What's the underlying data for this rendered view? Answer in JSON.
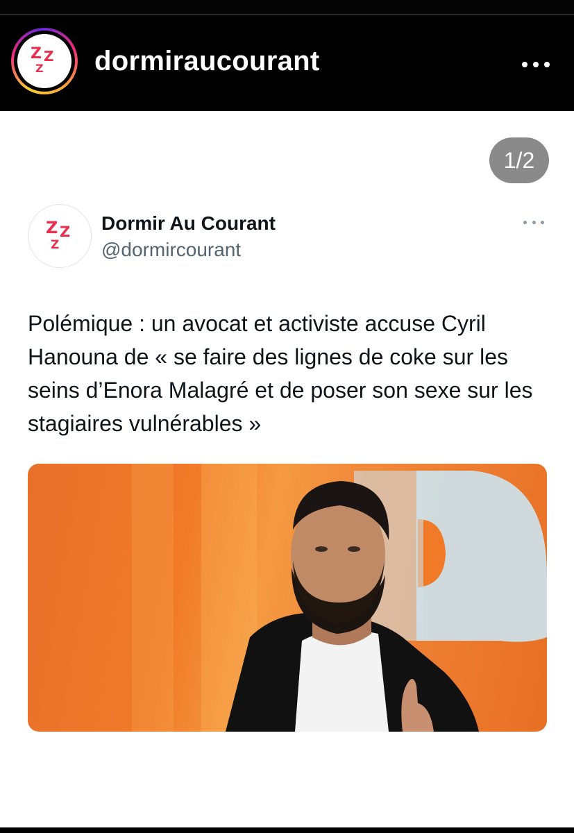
{
  "header": {
    "username": "dormiraucourant",
    "avatar_icon": "zzz-logo-icon",
    "more_icon": "more-horizontal-icon"
  },
  "post": {
    "counter": "1/2",
    "tweet": {
      "display_name": "Dormir Au Courant",
      "handle": "@dormircourant",
      "text": "Polémique : un avocat et activiste accuse Cyril Hanouna de « se faire des lignes de coke sur les seins d’Enora Malagré et de poser son sexe sur les stagiaires vulnérables »",
      "avatar_icon": "zzz-logo-icon",
      "more_icon": "more-horizontal-icon",
      "image_description": "photo"
    }
  },
  "colors": {
    "brand_red": "#e8314f",
    "background": "#000000",
    "post_bg": "#ffffff",
    "orange": "#f07a28"
  }
}
